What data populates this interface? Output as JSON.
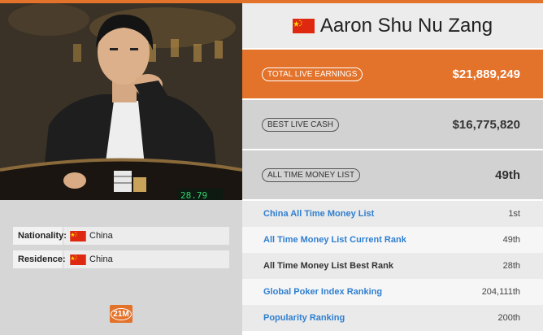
{
  "player": {
    "name": "Aaron Shu Nu Zang",
    "flag_icon": "china-flag-icon"
  },
  "facts": [
    {
      "label": "Nationality:",
      "value": "China",
      "flag_icon": "china-flag-icon"
    },
    {
      "label": "Residence:",
      "value": "China",
      "flag_icon": "china-flag-icon"
    }
  ],
  "brand_badge": {
    "text": "21M",
    "color": "#e3722a"
  },
  "stats": {
    "total_live_earnings": {
      "label": "TOTAL LIVE EARNINGS",
      "value": "$21,889,249"
    },
    "best_live_cash": {
      "label": "BEST LIVE CASH",
      "value": "$16,775,820"
    },
    "all_time_money_list": {
      "label": "ALL TIME MONEY LIST",
      "value": "49th"
    }
  },
  "rankings": [
    {
      "label": "China All Time Money List",
      "value": "1st",
      "link": true
    },
    {
      "label": "All Time Money List Current Rank",
      "value": "49th",
      "link": true
    },
    {
      "label": "All Time Money List Best Rank",
      "value": "28th",
      "link": false
    },
    {
      "label": "Global Poker Index Ranking",
      "value": "204,111th",
      "link": true
    },
    {
      "label": "Popularity Ranking",
      "value": "200th",
      "link": true
    }
  ],
  "colors": {
    "accent": "#e3722a",
    "link": "#2f7fd0",
    "flag_red": "#de2910",
    "flag_yellow": "#ffde00"
  }
}
